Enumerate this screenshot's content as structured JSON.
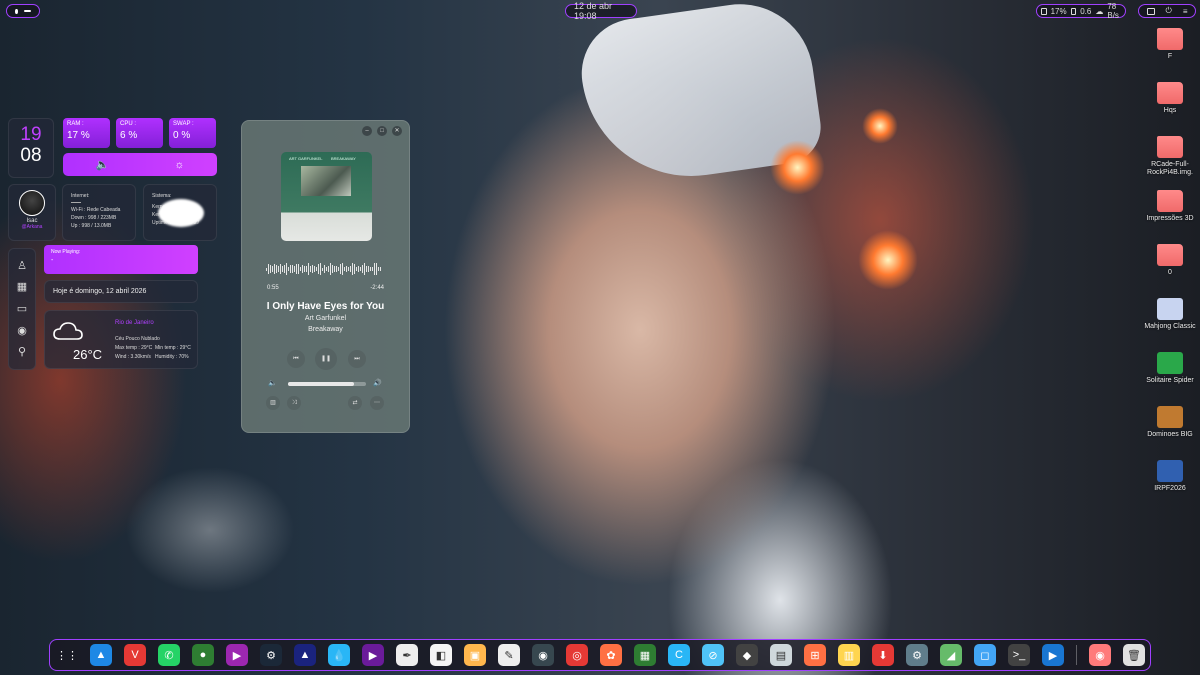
{
  "topbar": {
    "clock": "12 de abr 19:08",
    "cpu": "17%",
    "ram": "0.6",
    "net": "78 B/s"
  },
  "widgets": {
    "clock": {
      "hour": "19",
      "minute": "08"
    },
    "stats": [
      {
        "label": "RAM :",
        "value": "17 %"
      },
      {
        "label": "CPU :",
        "value": "6 %"
      },
      {
        "label": "SWAP :",
        "value": "0 %"
      }
    ],
    "user": {
      "name": "Isac",
      "role": "@Arkana"
    },
    "internet": {
      "title": "Internet:",
      "wifi": "Wi-Fi : Rede Cabeada",
      "down": "Down : 998 / 223MB",
      "up": "Up : 998 / 13.0MB"
    },
    "system": {
      "title": "Sistema:",
      "line1": "Kernel",
      "line2": "Ker",
      "uptime": "Uptime:3h:5M:20s:27"
    },
    "now_playing": {
      "title": "Now Playing:",
      "value": "-"
    },
    "date": "Hoje é domingo, 12 abril 2026",
    "weather": {
      "city": "Rio de Janeiro",
      "temp": "26°C",
      "desc": "Céu Pouco Nublado",
      "max": "Max temp : 29°C",
      "min": "Min temp : 29°C",
      "wind": "Wind : 3.30km/s",
      "humidity": "Humidity : 70%"
    },
    "side_nav": [
      "user-icon",
      "calendar-icon",
      "monitor-icon",
      "play-icon",
      "location-icon"
    ]
  },
  "player": {
    "album_band": "ART GARFUNKEL",
    "album_title": "BREAKAWAY",
    "elapsed": "0:55",
    "remaining": "-2:44",
    "song": "I Only Have Eyes for You",
    "artist": "Art Garfunkel",
    "album": "Breakaway",
    "volume": 0.85
  },
  "desktop_icons": [
    {
      "label": "F",
      "kind": "folder"
    },
    {
      "label": "Hqs",
      "kind": "folder"
    },
    {
      "label": "RCade-Full-RockPi4B.img.",
      "kind": "folder"
    },
    {
      "label": "Impressões 3D",
      "kind": "folder"
    },
    {
      "label": "0",
      "kind": "folder"
    },
    {
      "label": "Mahjong Classic",
      "kind": "app",
      "color": "#c8d4f0"
    },
    {
      "label": "Solitaire Spider",
      "kind": "app",
      "color": "#2aa84a"
    },
    {
      "label": "Dominoes BIG",
      "kind": "app",
      "color": "#c07a30"
    },
    {
      "label": "IRPF2026",
      "kind": "app",
      "color": "#3060b0"
    }
  ],
  "dock": [
    {
      "name": "apps-grid-icon",
      "color": "transparent",
      "glyph": "⋮⋮"
    },
    {
      "name": "arch-icon",
      "color": "#1e88e5",
      "glyph": "▲"
    },
    {
      "name": "vivaldi-icon",
      "color": "#e53935",
      "glyph": "V"
    },
    {
      "name": "whatsapp-icon",
      "color": "#25d366",
      "glyph": "✆"
    },
    {
      "name": "green-app-icon",
      "color": "#2e7d32",
      "glyph": "●"
    },
    {
      "name": "media-player-icon",
      "color": "#9c27b0",
      "glyph": "▶"
    },
    {
      "name": "steam-icon",
      "color": "#1b2838",
      "glyph": "⚙"
    },
    {
      "name": "triangle-app-icon",
      "color": "#1a237e",
      "glyph": "▲"
    },
    {
      "name": "drop-app-icon",
      "color": "#29b6f6",
      "glyph": "💧"
    },
    {
      "name": "purple-play-icon",
      "color": "#6a1b9a",
      "glyph": "▶"
    },
    {
      "name": "inkscape-icon",
      "color": "#eeeeee",
      "glyph": "✒"
    },
    {
      "name": "photos-icon",
      "color": "#f5f5f5",
      "glyph": "◧"
    },
    {
      "name": "archive-icon",
      "color": "#ffb74d",
      "glyph": "▣"
    },
    {
      "name": "text-editor-icon",
      "color": "#eeeeee",
      "glyph": "✎"
    },
    {
      "name": "disk-icon",
      "color": "#37474f",
      "glyph": "◉"
    },
    {
      "name": "video-editor-icon",
      "color": "#e53935",
      "glyph": "◎"
    },
    {
      "name": "color-app-icon",
      "color": "#ff7043",
      "glyph": "✿"
    },
    {
      "name": "spreadsheet-icon",
      "color": "#2e7d32",
      "glyph": "▦"
    },
    {
      "name": "c-app-icon",
      "color": "#29b6f6",
      "glyph": "C"
    },
    {
      "name": "browser-icon",
      "color": "#4fc3f7",
      "glyph": "⊘"
    },
    {
      "name": "inkscape2-icon",
      "color": "#424242",
      "glyph": "◆"
    },
    {
      "name": "files-icon",
      "color": "#cfd8dc",
      "glyph": "▤"
    },
    {
      "name": "game-controller-icon",
      "color": "#ff7043",
      "glyph": "⊞"
    },
    {
      "name": "notes-icon",
      "color": "#ffd54f",
      "glyph": "▥"
    },
    {
      "name": "downloader-icon",
      "color": "#e53935",
      "glyph": "⬇"
    },
    {
      "name": "settings-icon",
      "color": "#607d8b",
      "glyph": "⚙"
    },
    {
      "name": "maps-icon",
      "color": "#66bb6a",
      "glyph": "◢"
    },
    {
      "name": "store-icon",
      "color": "#42a5f5",
      "glyph": "◻"
    },
    {
      "name": "terminal-icon",
      "color": "#424242",
      "glyph": ">_"
    },
    {
      "name": "player-icon",
      "color": "#1976d2",
      "glyph": "▶"
    },
    {
      "name": "screenshot-folder-icon",
      "color": "#ff7a7a",
      "glyph": "◉"
    },
    {
      "name": "trash-icon",
      "color": "#e0e0e0",
      "glyph": "🗑"
    }
  ]
}
